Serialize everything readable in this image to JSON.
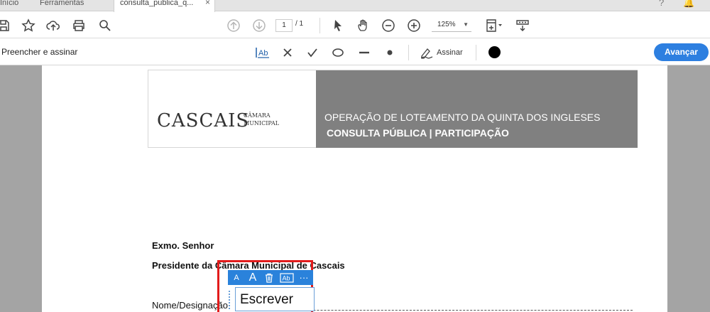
{
  "tabs": {
    "home": "Início",
    "tools": "Ferramentas",
    "document": "consulta_publica_q..."
  },
  "toolbar": {
    "page_current": "1",
    "page_total": "/ 1",
    "zoom": "125%"
  },
  "fill_sign": {
    "title": "Preencher e assinar",
    "sign_label": "Assinar",
    "next_button": "Avançar",
    "current_color": "#000000"
  },
  "document": {
    "logo_name": "CASCAIS",
    "logo_sub_1": "CÂMARA",
    "logo_sub_2": "MUNICIPAL",
    "heading_line1": "OPERAÇÃO DE LOTEAMENTO DA QUINTA DOS INGLESES",
    "heading_line2": "CONSULTA PÚBLICA | PARTICIPAÇÃO",
    "salutation": "Exmo. Senhor",
    "addressee": "Presidente da Câmara Municipal de Cascais",
    "name_label": "Nome/Designação"
  },
  "text_field": {
    "value": "Escrever"
  },
  "colors": {
    "accent": "#2d7fe0",
    "highlight_border": "#e21b1b",
    "header_gray": "#808080"
  }
}
